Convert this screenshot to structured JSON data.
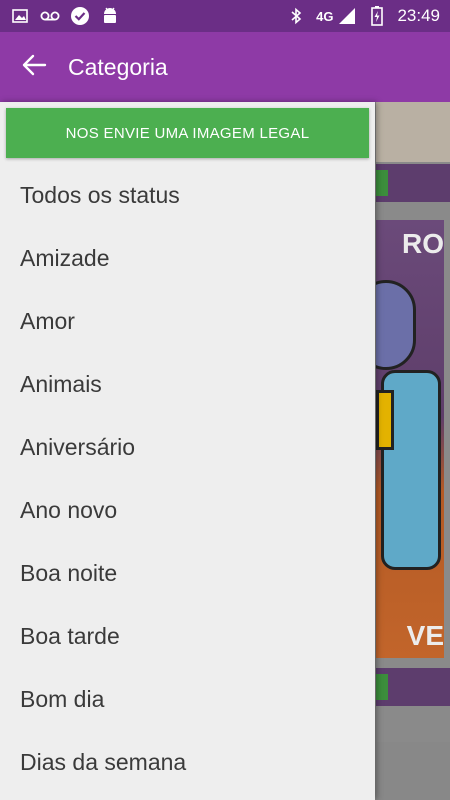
{
  "status_bar": {
    "time": "23:49",
    "network": "4G",
    "icons": [
      "image-icon",
      "voicemail-icon",
      "check-circle-icon",
      "android-icon",
      "bluetooth-icon",
      "signal-icon",
      "battery-charging-icon"
    ]
  },
  "app_bar": {
    "title": "Categoria",
    "back_icon": "arrow-back-icon"
  },
  "drawer": {
    "cta_label": "NOS ENVIE UMA IMAGEM LEGAL",
    "cta_color": "#4caf50",
    "categories": [
      "Todos os status",
      "Amizade",
      "Amor",
      "Animais",
      "Aniversário",
      "Ano novo",
      "Boa noite",
      "Boa tarde",
      "Bom dia",
      "Dias da semana"
    ]
  },
  "background": {
    "image_text_top": "RO",
    "image_text_bottom": "VE"
  },
  "colors": {
    "status_bar": "#6b2e86",
    "app_bar": "#8e3aa6",
    "drawer_bg": "#eeeeee"
  }
}
